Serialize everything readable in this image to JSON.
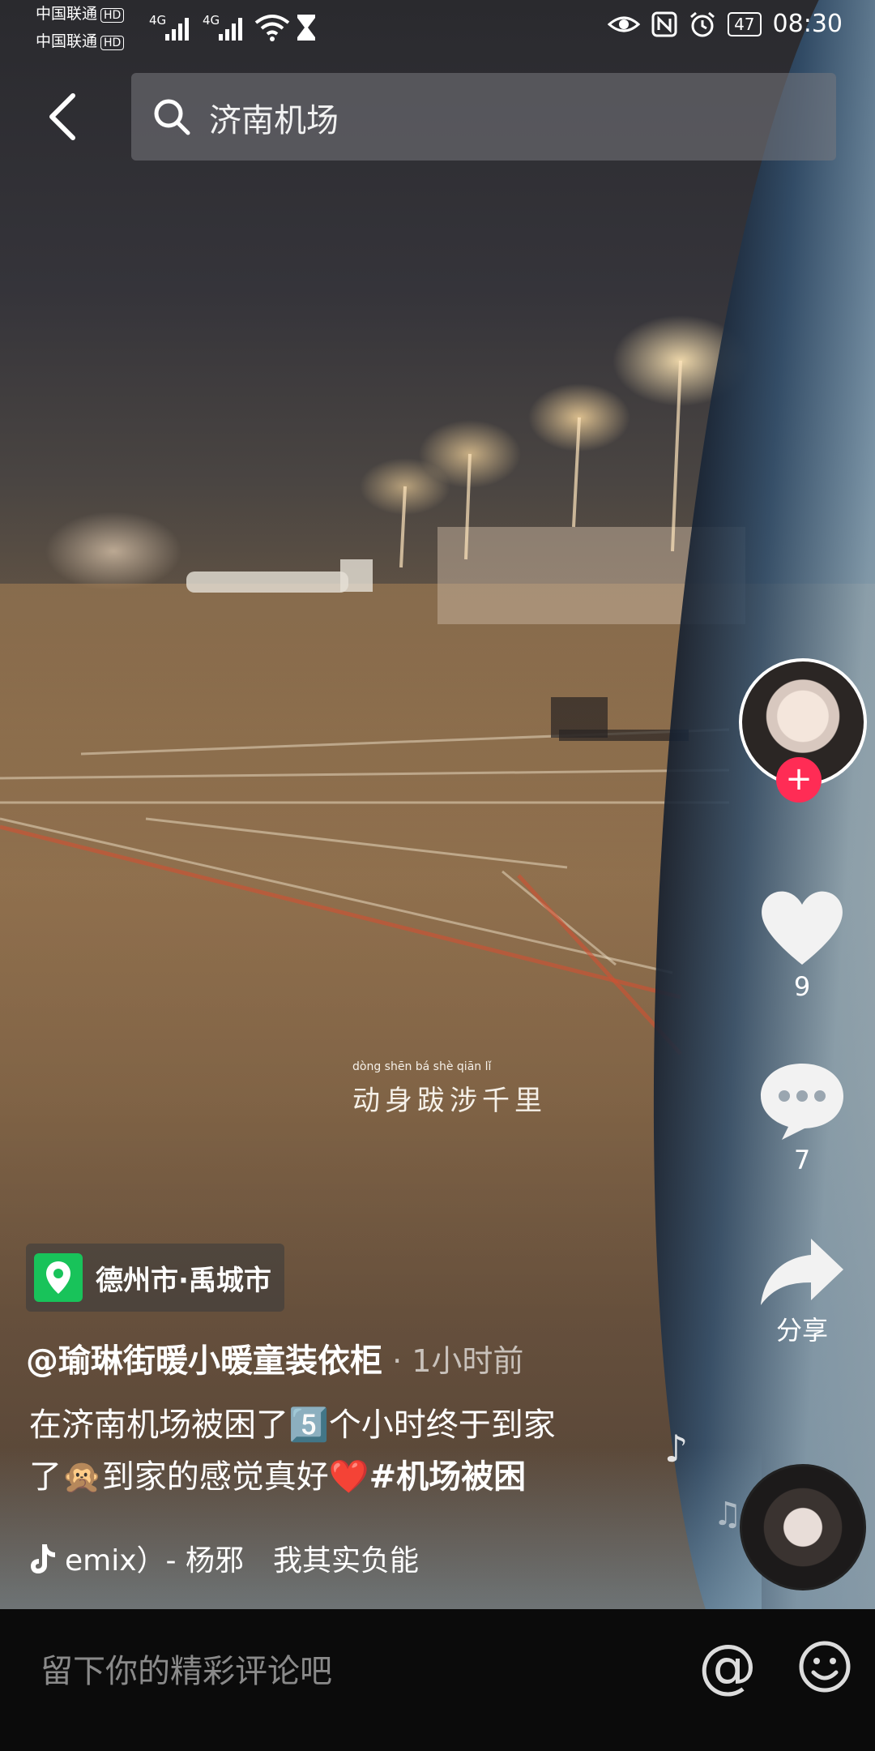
{
  "status_bar": {
    "carrier1": "中国联通",
    "carrier2": "中国联通",
    "hd": "HD",
    "network1": "4G",
    "network2": "4G",
    "battery": "47",
    "time": "08:30"
  },
  "search": {
    "query": "济南机场"
  },
  "video": {
    "caption_overlay": "动身跋涉千里",
    "caption_pinyin": "dòng shēn bá shè qiān lǐ"
  },
  "actions": {
    "likes": "9",
    "comments": "7",
    "share_label": "分享"
  },
  "post": {
    "location": "德州市·禹城市",
    "author": "@瑜琳街暖小暖童装依柜",
    "time_sep": " · ",
    "time": "1小时前",
    "description_line1": "在济南机场被困了5️⃣个小时终于到家",
    "description_line2": "了🙊到家的感觉真好❤️",
    "hashtag": "#机场被困",
    "music": "emix）- 杨邪　我其实负能"
  },
  "comment_bar": {
    "placeholder": "留下你的精彩评论吧",
    "at_symbol": "@"
  },
  "colors": {
    "follow_button": "#ff2c55",
    "location_pin": "#18c35a"
  }
}
